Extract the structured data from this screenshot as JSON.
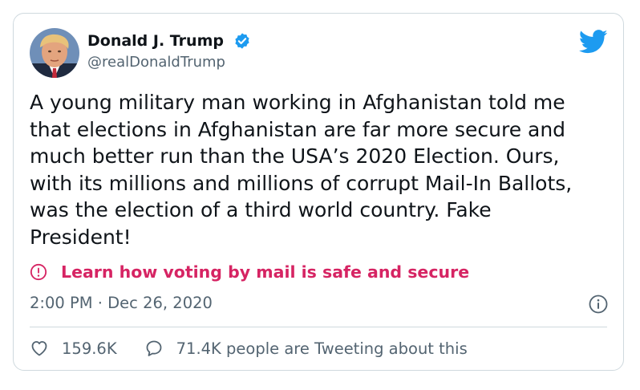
{
  "author": {
    "display_name": "Donald J. Trump",
    "handle": "@realDonaldTrump",
    "verified": true
  },
  "tweet": {
    "text": "A young military man working in Afghanistan told me\nthat elections in Afghanistan are far more secure and\nmuch better run than the USA’s 2020 Election. Ours,\nwith its millions and millions of corrupt Mail-In Ballots,\nwas the election of a third world country. Fake\nPresident!"
  },
  "notice": {
    "link_text": "Learn how voting by mail is safe and secure",
    "icon": "exclamation-circle-icon",
    "color": "#d62463"
  },
  "meta": {
    "timestamp": "2:00 PM · Dec 26, 2020"
  },
  "engagement": {
    "likes": "159.6K",
    "conversation": "71.4K people are Tweeting about this"
  },
  "colors": {
    "brand": "#1d9bf0",
    "text_primary": "#0f1419",
    "text_secondary": "#536471",
    "border": "#cfd9de"
  },
  "icons": {
    "brand": "twitter-bird-icon",
    "verified": "verified-badge-icon",
    "info": "info-icon",
    "like": "heart-icon",
    "reply": "speech-bubble-icon"
  }
}
